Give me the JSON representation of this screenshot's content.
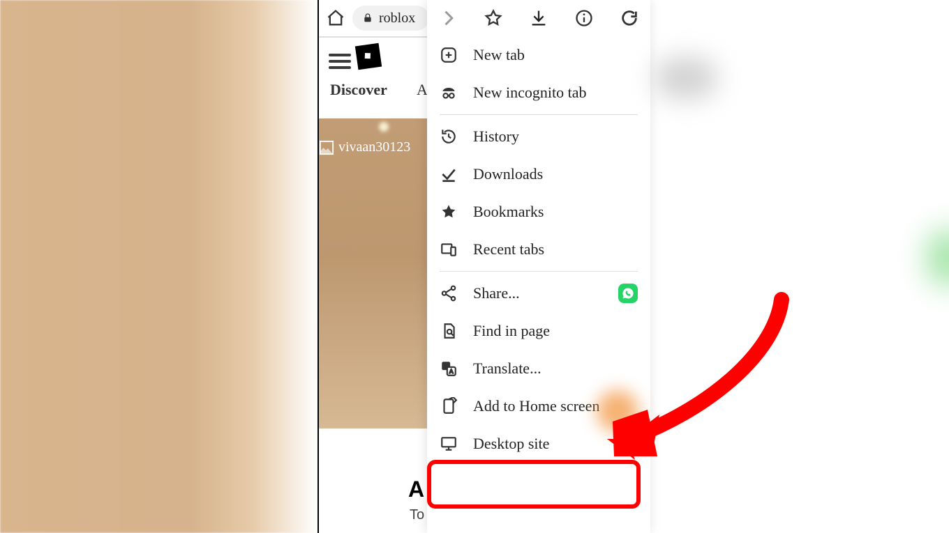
{
  "browser": {
    "domain": "roblox",
    "top_icons": {
      "home": "home-icon",
      "lock": "lock-icon",
      "forward": "forward-icon",
      "star": "star-icon",
      "download": "download-icon",
      "info": "info-icon",
      "reload": "reload-icon"
    }
  },
  "page": {
    "discover_label": "Discover",
    "tab2_partial": "A",
    "username": "vivaan30123",
    "about_heading": "A",
    "about_sub": "To o"
  },
  "menu": {
    "items": [
      {
        "id": "new-tab",
        "icon": "plus-box-icon",
        "label": "New tab"
      },
      {
        "id": "new-incognito",
        "icon": "incognito-icon",
        "label": "New incognito tab"
      },
      {
        "id": "history",
        "icon": "history-icon",
        "label": "History"
      },
      {
        "id": "downloads",
        "icon": "download-done-icon",
        "label": "Downloads"
      },
      {
        "id": "bookmarks",
        "icon": "star-filled-icon",
        "label": "Bookmarks"
      },
      {
        "id": "recent-tabs",
        "icon": "devices-icon",
        "label": "Recent tabs"
      },
      {
        "id": "share",
        "icon": "share-icon",
        "label": "Share...",
        "trailing": "whatsapp"
      },
      {
        "id": "find-in-page",
        "icon": "find-in-page-icon",
        "label": "Find in page"
      },
      {
        "id": "translate",
        "icon": "translate-icon",
        "label": "Translate..."
      },
      {
        "id": "add-home",
        "icon": "add-home-icon",
        "label": "Add to Home screen"
      },
      {
        "id": "desktop-site",
        "icon": "monitor-icon",
        "label": "Desktop site",
        "trailing": "checkbox",
        "checked": false
      }
    ]
  },
  "annotation": {
    "highlight_target": "desktop-site",
    "arrow_color": "#ff0000"
  }
}
